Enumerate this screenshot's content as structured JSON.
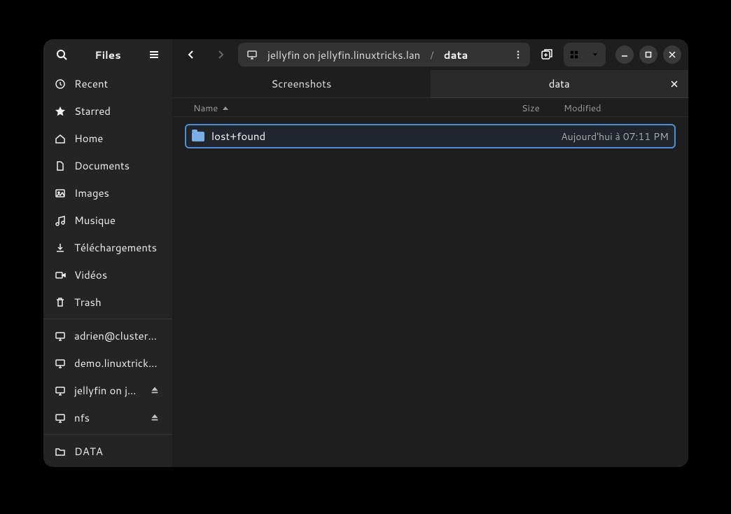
{
  "app_title": "Files",
  "path": {
    "server_label": "jellyfin on jellyfin.linuxtricks.lan",
    "current": "data"
  },
  "tabs": [
    {
      "label": "Screenshots",
      "active": false,
      "closable": false
    },
    {
      "label": "data",
      "active": true,
      "closable": true
    }
  ],
  "columns": {
    "name": "Name",
    "size": "Size",
    "modified": "Modified"
  },
  "sidebar": {
    "places": [
      {
        "id": "recent",
        "label": "Recent"
      },
      {
        "id": "starred",
        "label": "Starred"
      },
      {
        "id": "home",
        "label": "Home"
      },
      {
        "id": "documents",
        "label": "Documents"
      },
      {
        "id": "images",
        "label": "Images"
      },
      {
        "id": "music",
        "label": "Musique"
      },
      {
        "id": "downloads",
        "label": "Téléchargements"
      },
      {
        "id": "videos",
        "label": "Vidéos"
      },
      {
        "id": "trash",
        "label": "Trash"
      }
    ],
    "network": [
      {
        "id": "net0",
        "label": "adrien@cluster…",
        "eject": false
      },
      {
        "id": "net1",
        "label": "demo.linuxtrick…",
        "eject": false
      },
      {
        "id": "net2",
        "label": "jellyfin on j…",
        "eject": true
      },
      {
        "id": "net3",
        "label": "nfs",
        "eject": true
      }
    ],
    "bookmarks": [
      {
        "id": "data-folder",
        "label": "DATA"
      }
    ]
  },
  "files": [
    {
      "name": "lost+found",
      "size": "",
      "modified": "Aujourd'hui à 07:11 PM"
    }
  ]
}
